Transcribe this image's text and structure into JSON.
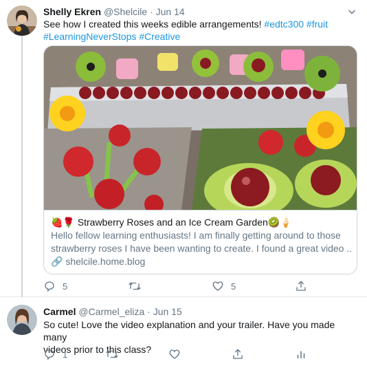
{
  "tweet1": {
    "display_name": "Shelly Ekren",
    "handle": "@Shelcile",
    "dot": "·",
    "time": "Jun 14",
    "text_plain": "See how I created this weeks edible arrangements!",
    "hashtag_1": "#edtc300",
    "hashtag_2": "#fruit",
    "hashtag_3": "#LearningNeverStops",
    "hashtag_4": "#Creative",
    "card": {
      "title_emoji": "🍓🌹",
      "title": "Strawberry Roses and an Ice Cream Garden",
      "title_emoji_end": "🥝🍦",
      "description_line1": "Hello fellow learning enthusiasts! I am finally getting around to those",
      "description_line2": "strawberry roses I have been wanting to create. I found a great video ...",
      "link_icon": "🔗",
      "domain": "shelcile.home.blog"
    },
    "actions": {
      "reply_count": "5",
      "retweet_count": "",
      "like_count": "5",
      "share_count": ""
    }
  },
  "tweet2": {
    "display_name": "Carmel",
    "handle": "@Carmel_eliza",
    "dot": "·",
    "time": "Jun 15",
    "text_line1": "So cute! Love the video explanation and your trailer. Have you made many",
    "text_line2": "videos prior to this class?",
    "actions": {
      "reply_count": "1",
      "retweet_count": "",
      "like_count": "",
      "share_count": ""
    }
  },
  "colors": {
    "link": "#1b95e0",
    "secondary_text": "#657786",
    "border": "#ccd6dd"
  }
}
